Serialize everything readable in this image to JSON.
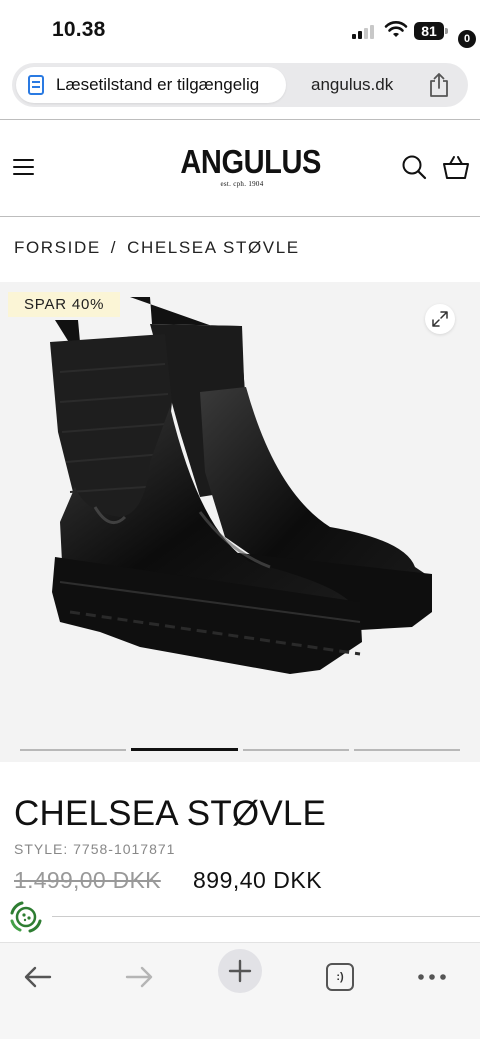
{
  "status_bar": {
    "time": "10.38",
    "battery": "81"
  },
  "browser": {
    "reader_label": "Læsetilstand er tilgængelig",
    "domain": "angulus.dk"
  },
  "site": {
    "logo": "ANGULUS",
    "logo_sub": "est. cph. 1904",
    "cart_count": "0"
  },
  "breadcrumb": {
    "home": "FORSIDE",
    "separator": "/",
    "current": "CHELSEA STØVLE"
  },
  "product": {
    "badge": "SPAR 40%",
    "title": "CHELSEA STØVLE",
    "style": "STYLE: 7758-1017871",
    "price_old": "1.499,00 DKK",
    "price_new": "899,40 DKK",
    "image_count": 4,
    "active_image": 2
  },
  "toolbar": {
    "tabs_icon": ":)"
  },
  "icons": {
    "reader": "reader-mode-icon",
    "share": "share-icon",
    "menu": "hamburger-menu-icon",
    "search": "search-icon",
    "cart": "cart-icon",
    "zoom": "expand-icon",
    "back": "back-arrow-icon",
    "forward": "forward-arrow-icon",
    "new_tab": "plus-icon",
    "tabs": "tabs-icon",
    "more": "more-icon"
  },
  "colors": {
    "badge_bg": "#fbf5d6",
    "reader_accent": "#2a7ae2",
    "consent_green": "#2e7d32"
  }
}
